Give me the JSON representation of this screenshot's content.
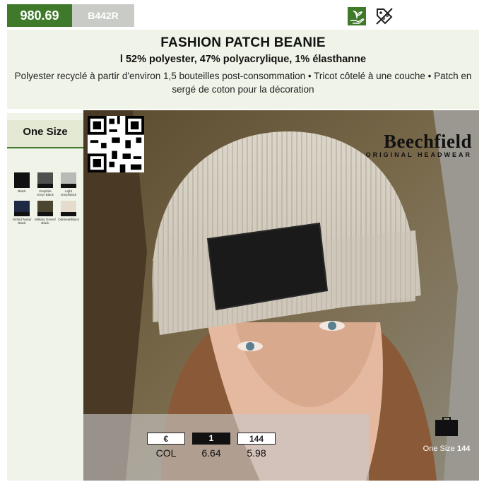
{
  "product": {
    "article_no": "980.69",
    "model": "B442R",
    "title": "FASHION PATCH BEANIE",
    "composition": "l 52% polyester, 47% polyacrylique, 1% élasthanne",
    "description": "Polyester recyclé à partir d'environ 1,5 bouteilles post-consommation • Tricot côtelé à une couche • Patch en sergé de coton pour la décoration"
  },
  "icons": {
    "eco": "eco-plant-hand-icon",
    "promo": "discount-tag-icon",
    "qr": "qr-code-icon",
    "carton": "carton-box-icon"
  },
  "sizes": {
    "label": "One Size"
  },
  "colors": [
    {
      "name": "Black",
      "top": "#111111",
      "bottom": "#111111"
    },
    {
      "name": "Graphite Grey/ Black",
      "top": "#4d504d",
      "bottom": "#111111"
    },
    {
      "name": "Light Grey/Black",
      "top": "#b8bab8",
      "bottom": "#111111"
    },
    {
      "name": "Oxford Navy/ Black",
      "top": "#1e2a44",
      "bottom": "#111111"
    },
    {
      "name": "Military Green/ Black",
      "top": "#4a4630",
      "bottom": "#111111"
    },
    {
      "name": "Oatmeal/Black",
      "top": "#e6dccd",
      "bottom": "#111111"
    }
  ],
  "brand": {
    "name": "Beechfield",
    "tagline": "ORIGINAL HEADWEAR"
  },
  "pricing": [
    {
      "header": "€",
      "style": "outline",
      "value": "COL"
    },
    {
      "header": "1",
      "style": "solid",
      "value": "6.64"
    },
    {
      "header": "144",
      "style": "outline",
      "value": "5.98"
    }
  ],
  "carton": {
    "label": "One Size",
    "quantity": "144"
  },
  "theme": {
    "accent": "#3f7a2b",
    "panel": "#f0f3e8"
  }
}
